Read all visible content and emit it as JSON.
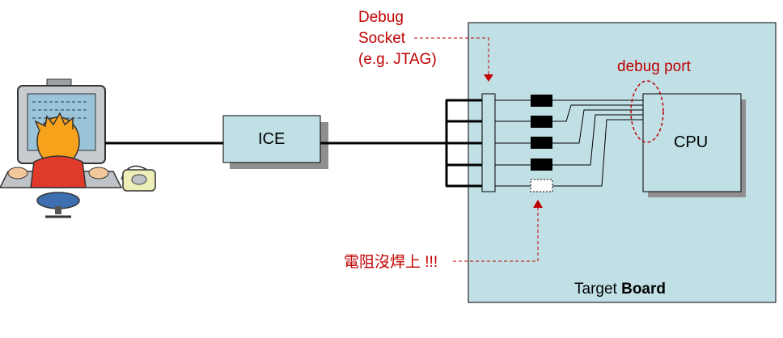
{
  "debug_socket_label": {
    "line1": "Debug",
    "line2": "Socket",
    "line3": "(e.g. JTAG)"
  },
  "debug_port_label": "debug port",
  "ice_label": "ICE",
  "cpu_label": "CPU",
  "board_label": {
    "normal": "Target ",
    "bold": "Board"
  },
  "resistor_note": "電阻沒焊上 !!!",
  "colors": {
    "board_fill": "#c0e0e6",
    "box_fill": "#c0e0e6",
    "annotation_red": "#c00000",
    "line": "#000000"
  },
  "icons": {
    "computer_user": "user-at-computer-icon"
  }
}
